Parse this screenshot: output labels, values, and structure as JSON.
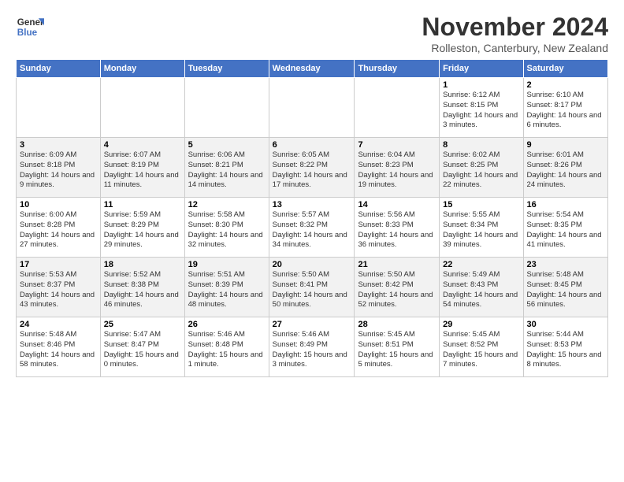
{
  "logo": {
    "line1": "General",
    "line2": "Blue"
  },
  "title": "November 2024",
  "subtitle": "Rolleston, Canterbury, New Zealand",
  "days_header": [
    "Sunday",
    "Monday",
    "Tuesday",
    "Wednesday",
    "Thursday",
    "Friday",
    "Saturday"
  ],
  "weeks": [
    [
      {
        "day": "",
        "info": ""
      },
      {
        "day": "",
        "info": ""
      },
      {
        "day": "",
        "info": ""
      },
      {
        "day": "",
        "info": ""
      },
      {
        "day": "",
        "info": ""
      },
      {
        "day": "1",
        "info": "Sunrise: 6:12 AM\nSunset: 8:15 PM\nDaylight: 14 hours and 3 minutes."
      },
      {
        "day": "2",
        "info": "Sunrise: 6:10 AM\nSunset: 8:17 PM\nDaylight: 14 hours and 6 minutes."
      }
    ],
    [
      {
        "day": "3",
        "info": "Sunrise: 6:09 AM\nSunset: 8:18 PM\nDaylight: 14 hours and 9 minutes."
      },
      {
        "day": "4",
        "info": "Sunrise: 6:07 AM\nSunset: 8:19 PM\nDaylight: 14 hours and 11 minutes."
      },
      {
        "day": "5",
        "info": "Sunrise: 6:06 AM\nSunset: 8:21 PM\nDaylight: 14 hours and 14 minutes."
      },
      {
        "day": "6",
        "info": "Sunrise: 6:05 AM\nSunset: 8:22 PM\nDaylight: 14 hours and 17 minutes."
      },
      {
        "day": "7",
        "info": "Sunrise: 6:04 AM\nSunset: 8:23 PM\nDaylight: 14 hours and 19 minutes."
      },
      {
        "day": "8",
        "info": "Sunrise: 6:02 AM\nSunset: 8:25 PM\nDaylight: 14 hours and 22 minutes."
      },
      {
        "day": "9",
        "info": "Sunrise: 6:01 AM\nSunset: 8:26 PM\nDaylight: 14 hours and 24 minutes."
      }
    ],
    [
      {
        "day": "10",
        "info": "Sunrise: 6:00 AM\nSunset: 8:28 PM\nDaylight: 14 hours and 27 minutes."
      },
      {
        "day": "11",
        "info": "Sunrise: 5:59 AM\nSunset: 8:29 PM\nDaylight: 14 hours and 29 minutes."
      },
      {
        "day": "12",
        "info": "Sunrise: 5:58 AM\nSunset: 8:30 PM\nDaylight: 14 hours and 32 minutes."
      },
      {
        "day": "13",
        "info": "Sunrise: 5:57 AM\nSunset: 8:32 PM\nDaylight: 14 hours and 34 minutes."
      },
      {
        "day": "14",
        "info": "Sunrise: 5:56 AM\nSunset: 8:33 PM\nDaylight: 14 hours and 36 minutes."
      },
      {
        "day": "15",
        "info": "Sunrise: 5:55 AM\nSunset: 8:34 PM\nDaylight: 14 hours and 39 minutes."
      },
      {
        "day": "16",
        "info": "Sunrise: 5:54 AM\nSunset: 8:35 PM\nDaylight: 14 hours and 41 minutes."
      }
    ],
    [
      {
        "day": "17",
        "info": "Sunrise: 5:53 AM\nSunset: 8:37 PM\nDaylight: 14 hours and 43 minutes."
      },
      {
        "day": "18",
        "info": "Sunrise: 5:52 AM\nSunset: 8:38 PM\nDaylight: 14 hours and 46 minutes."
      },
      {
        "day": "19",
        "info": "Sunrise: 5:51 AM\nSunset: 8:39 PM\nDaylight: 14 hours and 48 minutes."
      },
      {
        "day": "20",
        "info": "Sunrise: 5:50 AM\nSunset: 8:41 PM\nDaylight: 14 hours and 50 minutes."
      },
      {
        "day": "21",
        "info": "Sunrise: 5:50 AM\nSunset: 8:42 PM\nDaylight: 14 hours and 52 minutes."
      },
      {
        "day": "22",
        "info": "Sunrise: 5:49 AM\nSunset: 8:43 PM\nDaylight: 14 hours and 54 minutes."
      },
      {
        "day": "23",
        "info": "Sunrise: 5:48 AM\nSunset: 8:45 PM\nDaylight: 14 hours and 56 minutes."
      }
    ],
    [
      {
        "day": "24",
        "info": "Sunrise: 5:48 AM\nSunset: 8:46 PM\nDaylight: 14 hours and 58 minutes."
      },
      {
        "day": "25",
        "info": "Sunrise: 5:47 AM\nSunset: 8:47 PM\nDaylight: 15 hours and 0 minutes."
      },
      {
        "day": "26",
        "info": "Sunrise: 5:46 AM\nSunset: 8:48 PM\nDaylight: 15 hours and 1 minute."
      },
      {
        "day": "27",
        "info": "Sunrise: 5:46 AM\nSunset: 8:49 PM\nDaylight: 15 hours and 3 minutes."
      },
      {
        "day": "28",
        "info": "Sunrise: 5:45 AM\nSunset: 8:51 PM\nDaylight: 15 hours and 5 minutes."
      },
      {
        "day": "29",
        "info": "Sunrise: 5:45 AM\nSunset: 8:52 PM\nDaylight: 15 hours and 7 minutes."
      },
      {
        "day": "30",
        "info": "Sunrise: 5:44 AM\nSunset: 8:53 PM\nDaylight: 15 hours and 8 minutes."
      }
    ]
  ]
}
